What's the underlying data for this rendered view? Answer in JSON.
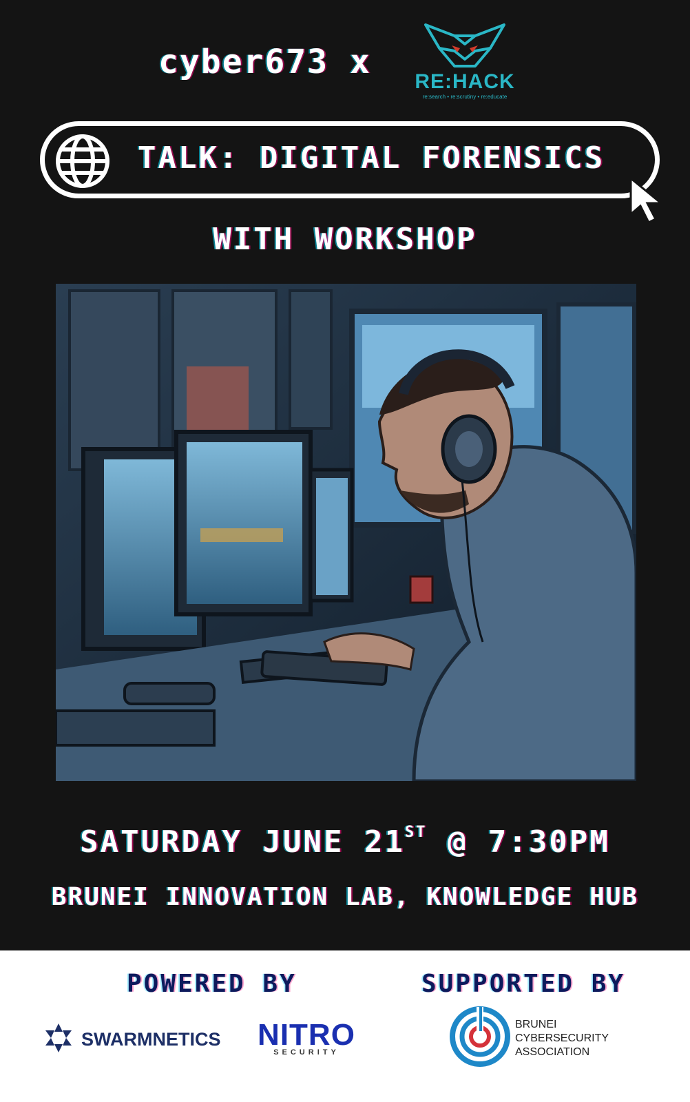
{
  "header": {
    "brand": "cyber673 x",
    "partner_name": "RE:HACK",
    "partner_tagline": "re:search • re:scrutiny • re:educate"
  },
  "talk": {
    "title": "TALK: DIGITAL FORENSICS",
    "subtitle": "WITH WORKSHOP"
  },
  "event": {
    "date_main": "SATURDAY JUNE 21",
    "date_suffix": "ST",
    "time": " @ 7:30PM",
    "venue": "BRUNEI INNOVATION LAB, KNOWLEDGE HUB"
  },
  "sponsors": {
    "powered_by_label": "POWERED BY",
    "supported_by_label": "SUPPORTED BY",
    "powered_by": [
      {
        "name": "SWARMNETICS"
      },
      {
        "name": "NITRO",
        "sub": "SECURITY"
      }
    ],
    "supported_by": {
      "line1": "BRUNEI",
      "line2": "CYBERSECURITY",
      "line3": "ASSOCIATION"
    }
  },
  "colors": {
    "background": "#141414",
    "accent_teal": "#2ab7c6",
    "navy": "#0d1a5c",
    "nitro_blue": "#1a2fb0"
  },
  "icons": {
    "globe": "globe-icon",
    "cursor": "cursor-icon",
    "wolf": "wolf-logo-icon"
  }
}
